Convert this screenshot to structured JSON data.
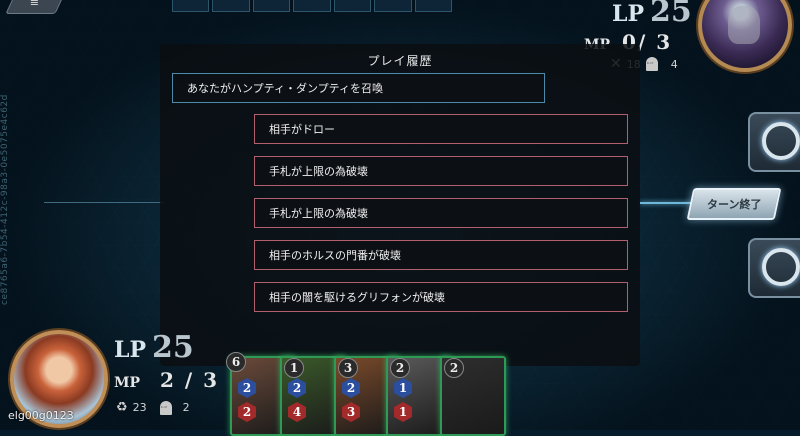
{
  "side_code": "ce8765a6-7b54-412c-98a3-0e5075e4c62d",
  "opponent": {
    "lp_label": "LP",
    "lp": "25",
    "mp_label": "MP",
    "mp": "0/ 3",
    "tomb_count": "18",
    "deck_count": "4"
  },
  "player": {
    "name": "elg00g0123",
    "lp_label": "LP",
    "lp": "25",
    "mp_label": "MP",
    "mp": "2 / 3",
    "deck_count": "23",
    "tomb_count": "2"
  },
  "turn_end_label": "ターン終了",
  "history": {
    "title": "プレイ履歴",
    "entries": [
      {
        "side": "self",
        "text": "あなたがハンプティ・ダンプティを召喚"
      },
      {
        "side": "opp",
        "text": "相手がドロー"
      },
      {
        "side": "opp",
        "text": "手札が上限の為破壊"
      },
      {
        "side": "opp",
        "text": "手札が上限の為破壊"
      },
      {
        "side": "opp",
        "text": "相手のホルスの門番が破壊"
      },
      {
        "side": "opp",
        "text": "相手の闇を駆けるグリフォンが破壊"
      }
    ]
  },
  "hand": [
    {
      "cost": "6",
      "atk": "2",
      "hp": "2",
      "color": "#6a4a3a"
    },
    {
      "cost": "1",
      "atk": "2",
      "hp": "4",
      "color": "#3b5a2a"
    },
    {
      "cost": "3",
      "atk": "2",
      "hp": "3",
      "color": "#7a4a2a"
    },
    {
      "cost": "2",
      "atk": "1",
      "hp": "1",
      "color": "#5a5a5a"
    },
    {
      "cost": "2",
      "atk": "",
      "hp": "",
      "color": "#2e2e2e"
    }
  ],
  "colors": {
    "self_border": "#4b8aa8",
    "opp_border": "#b2606f",
    "card_glow": "#2f9a55"
  }
}
